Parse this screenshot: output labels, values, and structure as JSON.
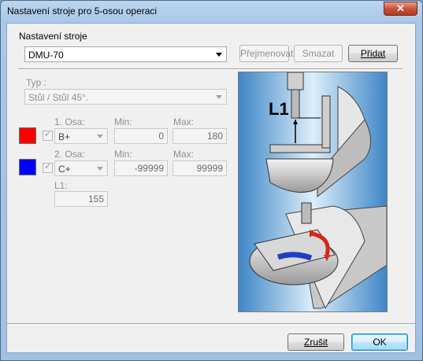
{
  "window": {
    "title": "Nastavení stroje pro 5-osou operaci",
    "close_glyph": "✕"
  },
  "machine": {
    "group_label": "Nastavení stroje",
    "selected": "DMU-70",
    "rename_label": "Přejmenovat",
    "delete_label": "Smazat",
    "add_label": "Přidat"
  },
  "type": {
    "label": "Typ :",
    "selected": "Stůl / Stůl 45°."
  },
  "axis1": {
    "label": "1. Osa:",
    "value": "B+",
    "min_label": "Min:",
    "min": "0",
    "max_label": "Max:",
    "max": "180",
    "color": "#ff0000",
    "checked": true
  },
  "axis2": {
    "label": "2. Osa:",
    "value": "C+",
    "min_label": "Min:",
    "min": "-99999",
    "max_label": "Max:",
    "max": "99999",
    "color": "#0000ff",
    "checked": true
  },
  "l1": {
    "label": "L1:",
    "value": "155"
  },
  "illustration": {
    "l1_text": "L1"
  },
  "footer": {
    "cancel_label": "Zrušit",
    "ok_label": "OK"
  },
  "colors": {
    "accent_blue": "#3c7fb1",
    "title_bg": "#a9c8e8"
  }
}
